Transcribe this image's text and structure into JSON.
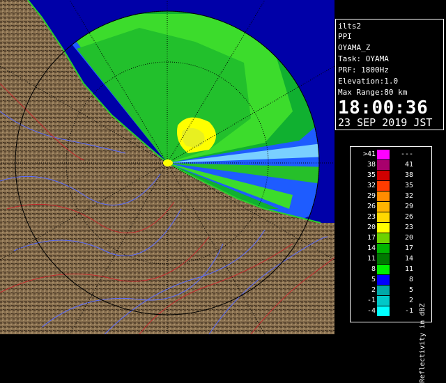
{
  "info": {
    "product": "ilts2",
    "scan_type": "PPI",
    "radar": "OYAMA_Z",
    "task": "Task: OYAMA",
    "prf": "PRF: 1800Hz",
    "elevation": "Elevation:1.0",
    "max_range": "Max Range:80 km",
    "time": "18:00:36",
    "date": "23 SEP 2019 JST"
  },
  "legend": {
    "title": "Reflectivity in dBZ",
    "bins": [
      {
        "low": ">41",
        "high": "---",
        "color": "#ff00ff"
      },
      {
        "low": "38",
        "high": "41",
        "color": "#a8006c"
      },
      {
        "low": "35",
        "high": "38",
        "color": "#d00000"
      },
      {
        "low": "32",
        "high": "35",
        "color": "#ff3c00"
      },
      {
        "low": "29",
        "high": "32",
        "color": "#ff8c00"
      },
      {
        "low": "26",
        "high": "29",
        "color": "#ffb400"
      },
      {
        "low": "23",
        "high": "26",
        "color": "#ffd800"
      },
      {
        "low": "20",
        "high": "23",
        "color": "#ffff00"
      },
      {
        "low": "17",
        "high": "20",
        "color": "#6cd200"
      },
      {
        "low": "14",
        "high": "17",
        "color": "#00b400"
      },
      {
        "low": "11",
        "high": "14",
        "color": "#007800"
      },
      {
        "low": "8",
        "high": "11",
        "color": "#00f000"
      },
      {
        "low": "5",
        "high": "8",
        "color": "#0000ff"
      },
      {
        "low": "2",
        "high": "5",
        "color": "#00a8a8"
      },
      {
        "low": "-1",
        "high": "2",
        "color": "#00c8c8"
      },
      {
        "low": "-4",
        "high": "-1",
        "color": "#00ffff"
      }
    ]
  }
}
